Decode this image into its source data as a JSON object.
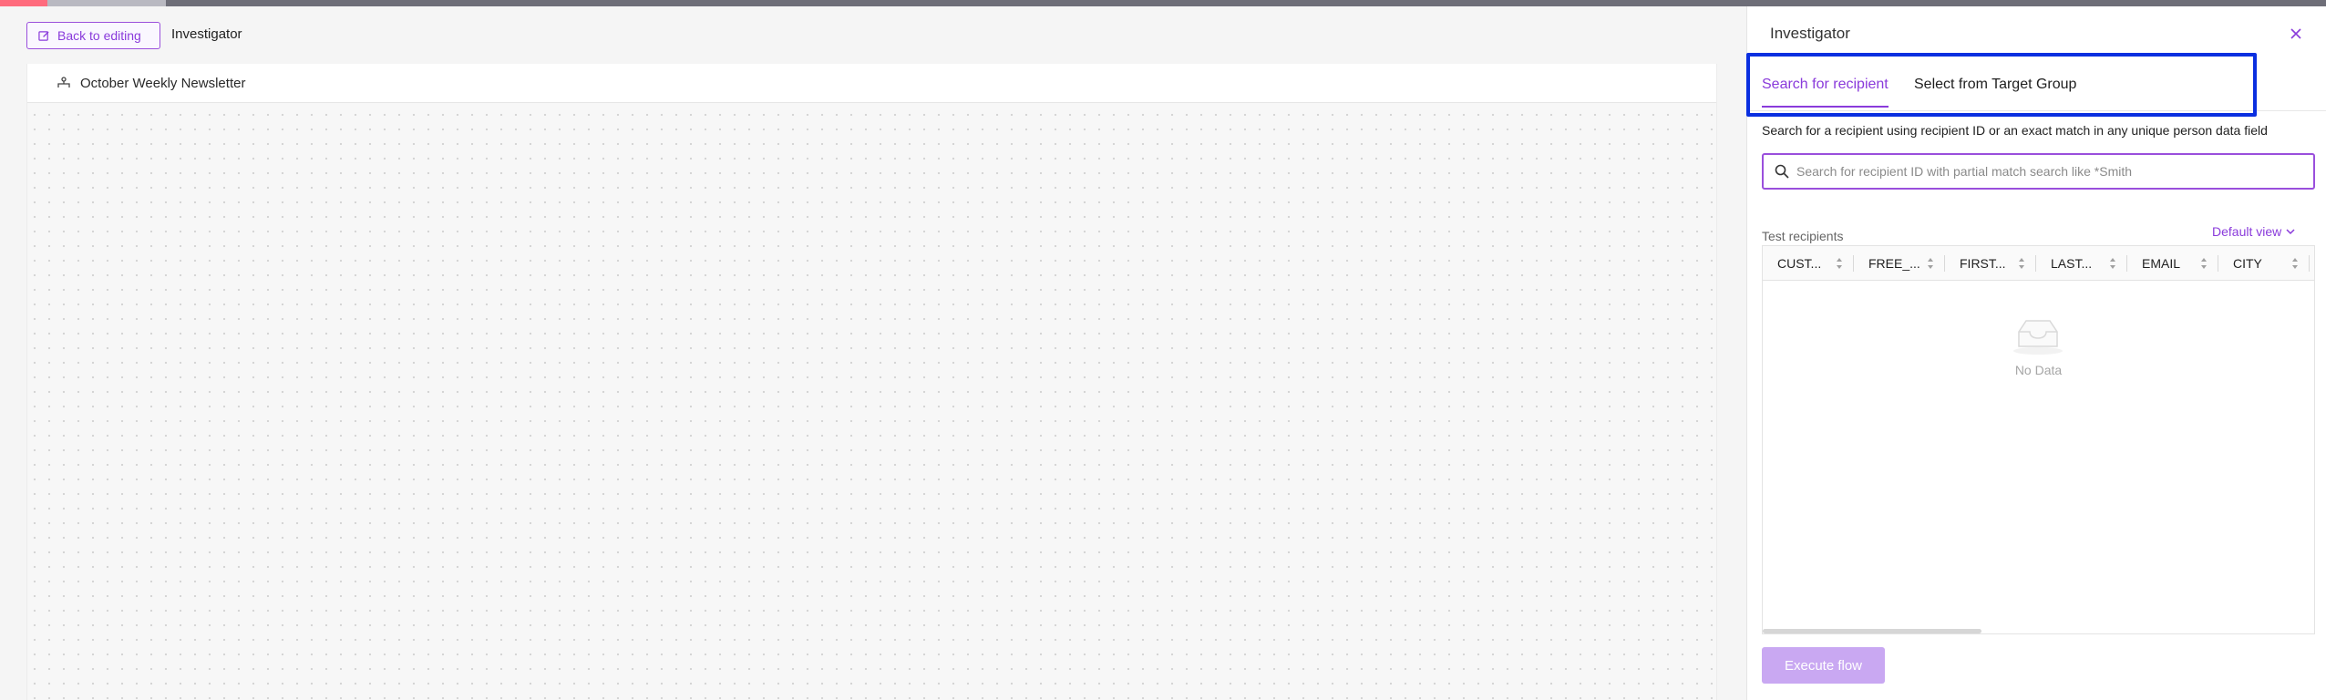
{
  "header": {
    "back_label": "Back to editing",
    "crumb": "Investigator"
  },
  "canvas": {
    "title": "October Weekly Newsletter"
  },
  "panel": {
    "title": "Investigator",
    "tabs": [
      {
        "label": "Search for recipient",
        "active": true
      },
      {
        "label": "Select from Target Group",
        "active": false
      }
    ],
    "description": "Search for a recipient using recipient ID or an exact match in any unique person data field",
    "search": {
      "placeholder": "Search for recipient ID with partial match search like *Smith",
      "value": ""
    },
    "test_recipients_label": "Test recipients",
    "view_label": "Default view",
    "columns": [
      "CUST...",
      "FREE_...",
      "FIRST...",
      "LAST...",
      "EMAIL",
      "CITY"
    ],
    "empty_text": "No Data",
    "execute_label": "Execute flow"
  },
  "colors": {
    "accent": "#8a3bdb",
    "highlight": "#0a2fe0",
    "execute_disabled": "#c9a8f2"
  },
  "icons": [
    "edit-icon",
    "flow-icon",
    "close-icon",
    "search-icon",
    "chevron-down-icon",
    "sort-icon",
    "inbox-icon"
  ]
}
